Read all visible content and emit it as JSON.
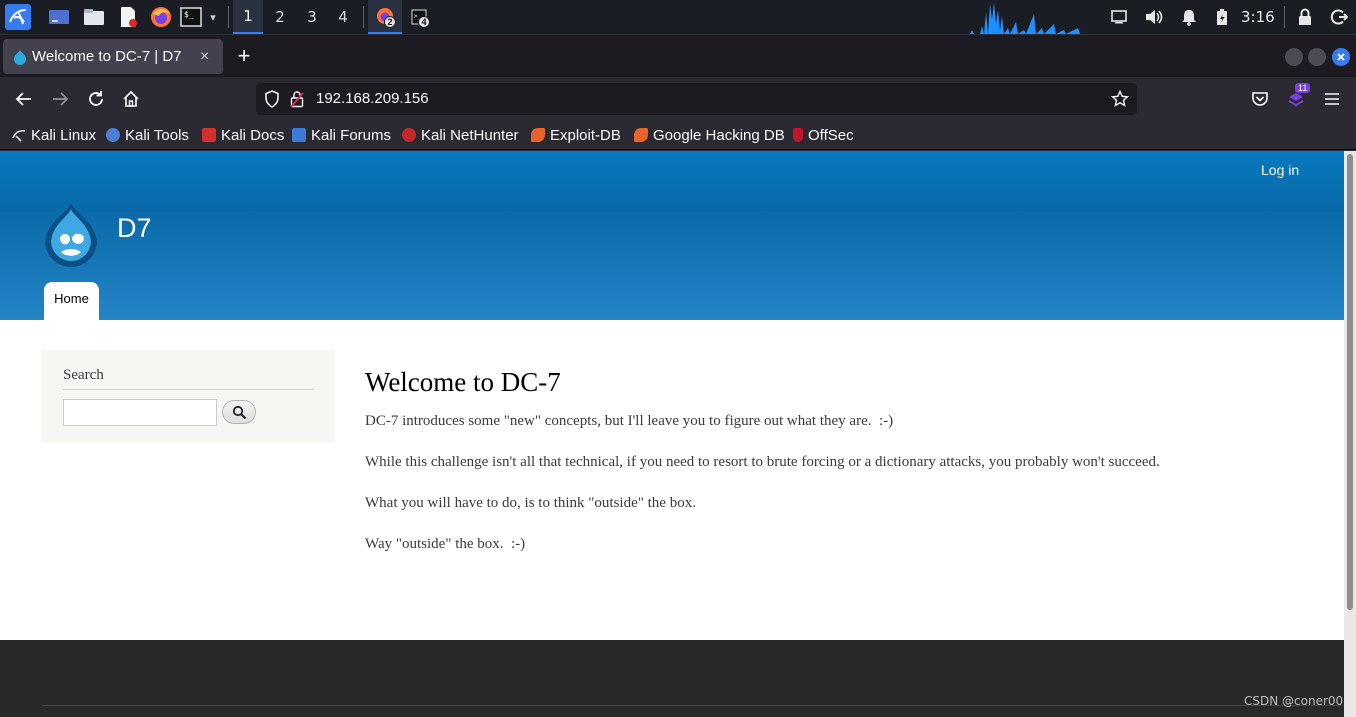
{
  "panel": {
    "workspaces": [
      "1",
      "2",
      "3",
      "4"
    ],
    "active_workspace": "1",
    "badges": {
      "firefox_windows": "2",
      "terminal_windows": "4"
    },
    "clock": "3:16"
  },
  "browser": {
    "tab_title": "Welcome to DC-7 | D7",
    "tab_close": "×",
    "new_tab": "+",
    "url": "192.168.209.156",
    "extension_badge": "11",
    "bookmarks": [
      "Kali Linux",
      "Kali Tools",
      "Kali Docs",
      "Kali Forums",
      "Kali NetHunter",
      "Exploit-DB",
      "Google Hacking DB",
      "OffSec"
    ]
  },
  "site": {
    "login_link": "Log in",
    "name": "D7",
    "nav": {
      "home": "Home"
    },
    "sidebar": {
      "search_label": "Search"
    },
    "main": {
      "title": "Welcome to DC-7",
      "paragraphs": [
        "DC-7 introduces some \"new\" concepts, but I'll leave you to figure out what they are.  :-)",
        "While this challenge isn't all that technical, if you need to resort to brute forcing or a dictionary attacks, you probably won't succeed.",
        "What you will have to do, is to think \"outside\" the box.",
        "Way \"outside\" the box.  :-)"
      ]
    }
  },
  "watermark": "CSDN @coner00",
  "colors": {
    "header_blue": "#0779bf",
    "header_blue_light": "#2385c6",
    "panel_bg": "#1b1d24",
    "browser_bg": "#2b2a33",
    "footer_bg": "#292929"
  }
}
